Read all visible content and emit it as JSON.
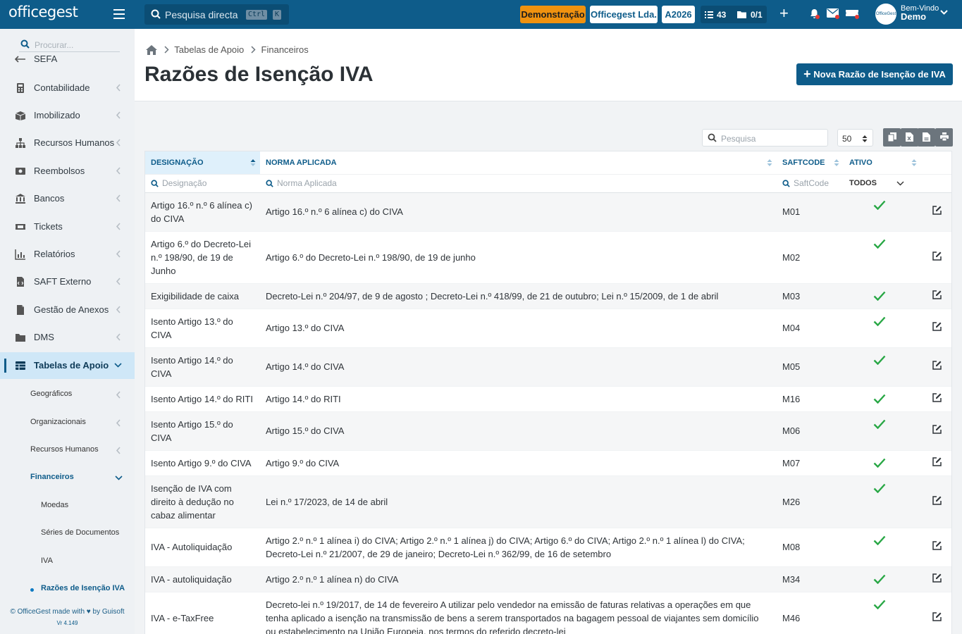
{
  "app": {
    "logo_text": "officegest",
    "quick_search_placeholder": "Pesquisa directa",
    "shortcut_keys": [
      "Ctrl",
      "K"
    ],
    "demo_badge": "Demonstração",
    "company_badge": "Officegest Lda.",
    "year_badge": "A2026",
    "tasks_count": "43",
    "docs_count": "0/1",
    "welcome_text": "Bem-Vindo",
    "user_name": "Demo"
  },
  "sidebar": {
    "search_placeholder": "Procurar...",
    "items": [
      {
        "label": "SEFA",
        "icon": "arrow-left-icon"
      },
      {
        "label": "Contabilidade",
        "icon": "calculator-icon"
      },
      {
        "label": "Imobilizado",
        "icon": "box-icon"
      },
      {
        "label": "Recursos Humanos",
        "icon": "sitemap-icon"
      },
      {
        "label": "Reembolsos",
        "icon": "money-icon"
      },
      {
        "label": "Bancos",
        "icon": "bank-icon"
      },
      {
        "label": "Tickets",
        "icon": "ticket-icon"
      },
      {
        "label": "Relatórios",
        "icon": "chart-icon"
      },
      {
        "label": "SAFT Externo",
        "icon": "file-code-icon"
      },
      {
        "label": "Gestão de Anexos",
        "icon": "file-icon"
      },
      {
        "label": "DMS",
        "icon": "folder-icon"
      },
      {
        "label": "Tabelas de Apoio",
        "icon": "table-icon"
      }
    ],
    "sub_items": [
      {
        "label": "Geográficos"
      },
      {
        "label": "Organizacionais"
      },
      {
        "label": "Recursos Humanos"
      },
      {
        "label": "Financeiros"
      }
    ],
    "sub_sub_items": [
      {
        "label": "Moedas"
      },
      {
        "label": "Séries de Documentos"
      },
      {
        "label": "IVA"
      },
      {
        "label": "Razões de Isenção IVA"
      }
    ],
    "footer_text": "© OfficeGest made with ♥ by Guisoft",
    "version": "Vr 4.149"
  },
  "breadcrumb": {
    "items": [
      "Tabelas de Apoio",
      "Financeiros"
    ]
  },
  "page": {
    "title": "Razões de Isenção IVA",
    "new_button": "Nova Razão de Isenção de IVA"
  },
  "toolbar": {
    "search_placeholder": "Pesquisa",
    "page_size": "50"
  },
  "table": {
    "columns": [
      "DESIGNAÇÃO",
      "NORMA APLICADA",
      "SAFTCODE",
      "ATIVO"
    ],
    "filters": [
      "Designação",
      "Norma Aplicada",
      "SaftCode",
      "TODOS"
    ],
    "rows": [
      {
        "designacao": "Artigo 16.º n.º 6 alínea c) do CIVA",
        "norma": "Artigo 16.º n.º 6 alínea c) do CIVA",
        "saftcode": "M01",
        "ativo": true
      },
      {
        "designacao": "Artigo 6.º do Decreto-Lei n.º 198/90, de 19 de Junho",
        "norma": "Artigo 6.º do Decreto-Lei n.º 198/90, de 19 de junho",
        "saftcode": "M02",
        "ativo": true
      },
      {
        "designacao": "Exigibilidade de caixa",
        "norma": "Decreto-Lei n.º 204/97, de 9 de agosto ; Decreto-Lei n.º 418/99, de 21 de outubro; Lei n.º 15/2009, de 1 de abril",
        "saftcode": "M03",
        "ativo": true
      },
      {
        "designacao": "Isento Artigo 13.º do CIVA",
        "norma": "Artigo 13.º do CIVA",
        "saftcode": "M04",
        "ativo": true
      },
      {
        "designacao": "Isento Artigo 14.º do CIVA",
        "norma": "Artigo 14.º do CIVA",
        "saftcode": "M05",
        "ativo": true
      },
      {
        "designacao": "Isento Artigo 14.º do RITI",
        "norma": "Artigo 14.º do RITI",
        "saftcode": "M16",
        "ativo": true
      },
      {
        "designacao": "Isento Artigo 15.º do CIVA",
        "norma": "Artigo 15.º do CIVA",
        "saftcode": "M06",
        "ativo": true
      },
      {
        "designacao": "Isento Artigo 9.º do CIVA",
        "norma": "Artigo 9.º do CIVA",
        "saftcode": "M07",
        "ativo": true
      },
      {
        "designacao": "Isenção de IVA com direito à dedução no cabaz alimentar",
        "norma": "Lei n.º 17/2023, de 14 de abril",
        "saftcode": "M26",
        "ativo": true
      },
      {
        "designacao": "IVA - Autoliquidação",
        "norma": "Artigo 2.º n.º 1 alínea i) do CIVA; Artigo 2.º n.º 1 alínea j) do CIVA; Artigo 6.º do CIVA; Artigo 2.º n.º 1 alínea l) do CIVA; Decreto-Lei n.º 21/2007, de 29 de janeiro; Decreto-Lei n.º 362/99, de 16 de setembro",
        "saftcode": "M08",
        "ativo": true
      },
      {
        "designacao": "IVA - autoliquidação",
        "norma": "Artigo 2.º n.º 1 alínea n) do CIVA",
        "saftcode": "M34",
        "ativo": true
      },
      {
        "designacao": "IVA - e-TaxFree",
        "norma": "Decreto-lei n.º 19/2017, de 14 de fevereiro A utilizar pelo vendedor na emissão de faturas relativas a operações em que tenha aplicado a isenção na transmissão de bens a serem transportados na bagagem pessoal de viajantes sem domicílio ou estabelecimento na União Europeia, nos termos do referido decreto-lei",
        "saftcode": "M46",
        "ativo": true
      }
    ]
  },
  "colors": {
    "primary": "#0e5c8a",
    "warning": "#f0920f",
    "success": "#28a745",
    "active_row": "#cfe7f7"
  }
}
